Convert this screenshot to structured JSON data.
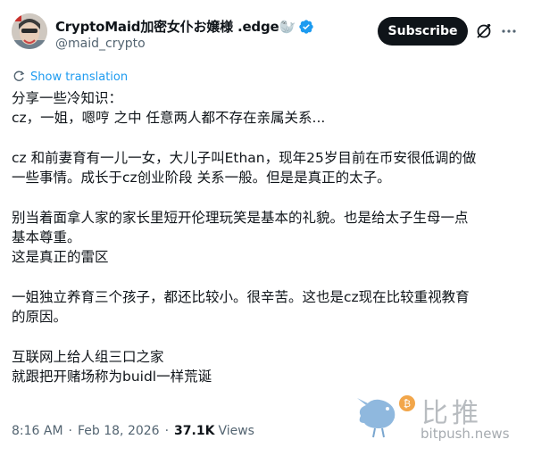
{
  "author": {
    "display_name": "CryptoMaid加密女仆お嬢様 .edge🦭",
    "handle": "@maid_crypto"
  },
  "actions": {
    "subscribe_label": "Subscribe",
    "grok_icon": "grok-icon",
    "more_icon": "more-icon"
  },
  "translate": {
    "label": "Show translation"
  },
  "tweet": {
    "lines": [
      "分享一些冷知识：",
      "cz，一姐，嗯哼 之中 任意两人都不存在亲属关系...",
      "",
      "cz 和前妻育有一儿一女，大儿子叫Ethan，现年25岁目前在币安很低调的做",
      "一些事情。成长于cz创业阶段 关系一般。但是是真正的太子。",
      "",
      "别当着面拿人家的家长里短开伦理玩笑是基本的礼貌。也是给太子生母一点",
      "基本尊重。",
      "这是真正的雷区",
      "",
      "一姐独立养育三个孩子，都还比较小。很辛苦。这也是cz现在比较重视教育",
      "的原因。",
      "",
      "互联网上给人组三口之家",
      "就跟把开赌场称为buidl一样荒诞"
    ]
  },
  "meta": {
    "time": "8:16 AM",
    "date": "Feb 18, 2026",
    "views_count": "37.1K",
    "views_label": "Views"
  },
  "watermark": {
    "cn": "比推",
    "en": "bitpush.news"
  },
  "colors": {
    "accent": "#1d9bf0",
    "text": "#0f1419",
    "secondary": "#536471"
  }
}
